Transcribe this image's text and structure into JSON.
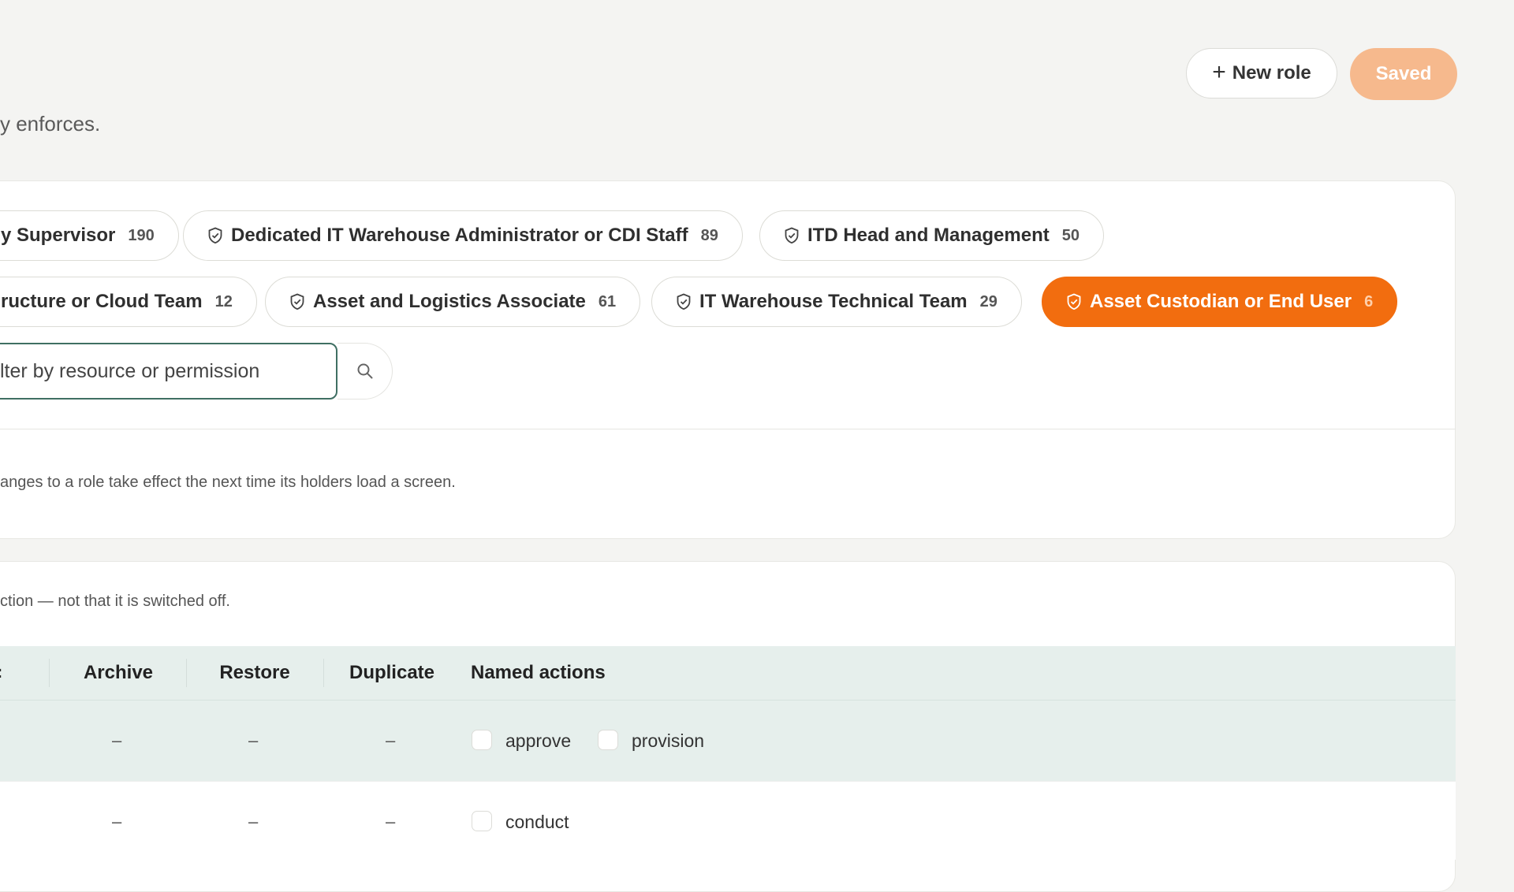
{
  "header": {
    "subtitle_fragment": "y enforces.",
    "new_role_label": "New role",
    "saved_label": "Saved"
  },
  "roles": [
    {
      "name": "y Supervisor",
      "count": "190"
    },
    {
      "name": "Dedicated IT Warehouse Administrator or CDI Staff",
      "count": "89"
    },
    {
      "name": "ITD Head and Management",
      "count": "50"
    },
    {
      "name": "ructure or Cloud Team",
      "count": "12"
    },
    {
      "name": "Asset and Logistics Associate",
      "count": "61"
    },
    {
      "name": "IT Warehouse Technical Team",
      "count": "29"
    },
    {
      "name": "Asset Custodian or End User",
      "count": "6"
    }
  ],
  "filter": {
    "value": "lter by resource or permission"
  },
  "role_note": "anges to a role take effect the next time its holders load a screen.",
  "matrix": {
    "note": "ction — not that it is switched off.",
    "columns": {
      "archive": "Archive",
      "restore": "Restore",
      "duplicate": "Duplicate",
      "named_actions": "Named actions"
    },
    "rows": [
      {
        "archive": "–",
        "restore": "–",
        "duplicate": "–",
        "actions": [
          "approve",
          "provision"
        ]
      },
      {
        "archive": "–",
        "restore": "–",
        "duplicate": "–",
        "actions": [
          "conduct"
        ]
      }
    ]
  },
  "colors": {
    "accent": "#f26d0f",
    "saved_button": "#f6b98d",
    "table_header": "#e6efec"
  }
}
